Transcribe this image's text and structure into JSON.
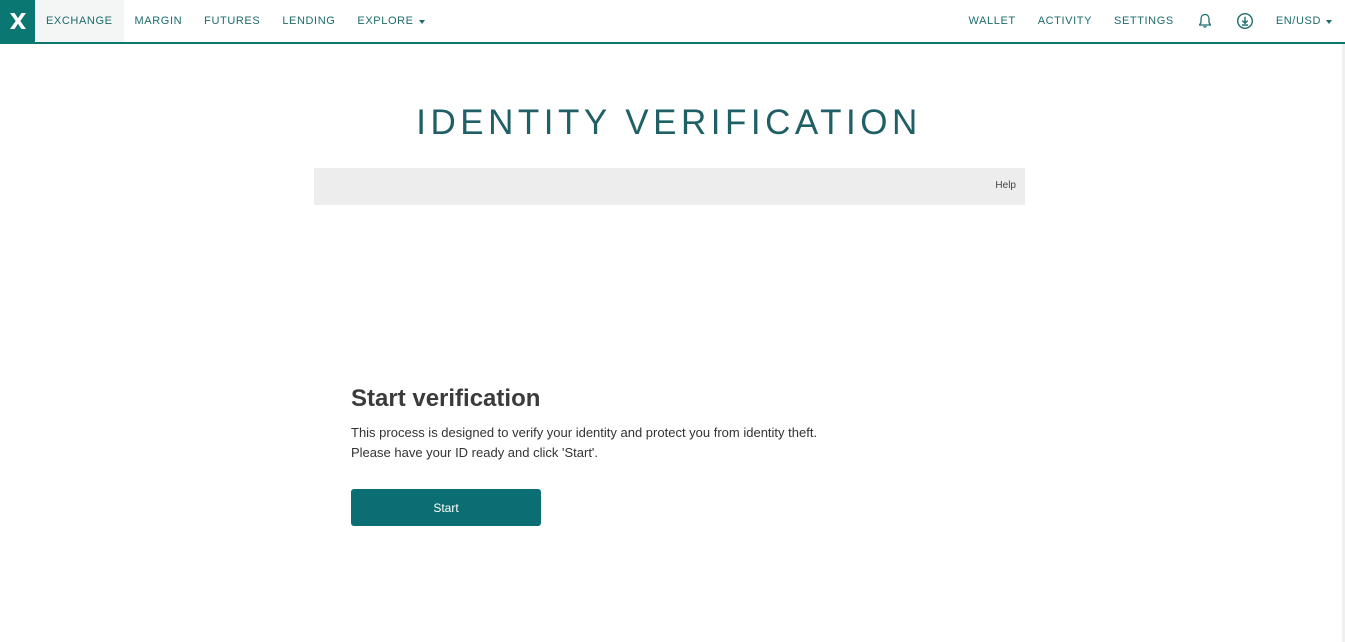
{
  "nav": {
    "left": [
      {
        "label": "EXCHANGE"
      },
      {
        "label": "MARGIN"
      },
      {
        "label": "FUTURES"
      },
      {
        "label": "LENDING"
      },
      {
        "label": "EXPLORE"
      }
    ],
    "right": [
      {
        "label": "WALLET"
      },
      {
        "label": "ACTIVITY"
      },
      {
        "label": "SETTINGS"
      }
    ],
    "locale": "EN/USD",
    "icons": [
      "logo-x-icon",
      "bell-icon",
      "download-icon"
    ]
  },
  "page": {
    "title": "IDENTITY VERIFICATION",
    "help_label": "Help"
  },
  "verification": {
    "heading": "Start verification",
    "line1": "This process is designed to verify your identity and protect you from identity theft.",
    "line2": "Please have your ID ready and click 'Start'.",
    "button_label": "Start"
  },
  "colors": {
    "accent": "#0b7773",
    "button": "#0b6e72",
    "title": "#1f5f66",
    "help_bar": "#ededed"
  }
}
